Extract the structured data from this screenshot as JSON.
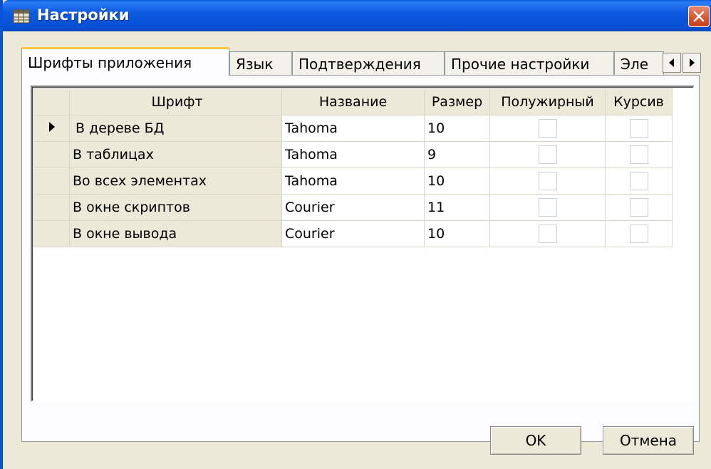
{
  "window": {
    "title": "Настройки"
  },
  "tabs": [
    {
      "label": "Шрифты приложения",
      "active": true
    },
    {
      "label": "Язык",
      "active": false
    },
    {
      "label": "Подтверждения",
      "active": false
    },
    {
      "label": "Прочие настройки",
      "active": false
    },
    {
      "label": "Эле",
      "active": false
    }
  ],
  "grid": {
    "columns": [
      "Шрифт",
      "Название",
      "Размер",
      "Полужирный",
      "Курсив"
    ],
    "rows": [
      {
        "font": "В дереве БД",
        "name": "Tahoma",
        "size": "10",
        "bold": false,
        "italic": false,
        "current": true
      },
      {
        "font": "В таблицах",
        "name": "Tahoma",
        "size": "9",
        "bold": false,
        "italic": false,
        "current": false
      },
      {
        "font": "Во всех элементах",
        "name": "Tahoma",
        "size": "10",
        "bold": false,
        "italic": false,
        "current": false
      },
      {
        "font": "В окне скриптов",
        "name": "Courier",
        "size": "11",
        "bold": false,
        "italic": false,
        "current": false
      },
      {
        "font": "В окне вывода",
        "name": "Courier",
        "size": "10",
        "bold": false,
        "italic": false,
        "current": false
      }
    ]
  },
  "buttons": {
    "ok": "OK",
    "cancel": "Отмена"
  },
  "icons": {
    "app": "settings-table-icon",
    "close": "close-icon",
    "row_indicator": "current-row-arrow-icon",
    "tab_left": "arrow-left-icon",
    "tab_right": "arrow-right-icon"
  },
  "colors": {
    "titlebar": "#0a5fe0",
    "close": "#d8542f",
    "face": "#ece9d8",
    "active_tab_accent": "#ffc83c"
  }
}
